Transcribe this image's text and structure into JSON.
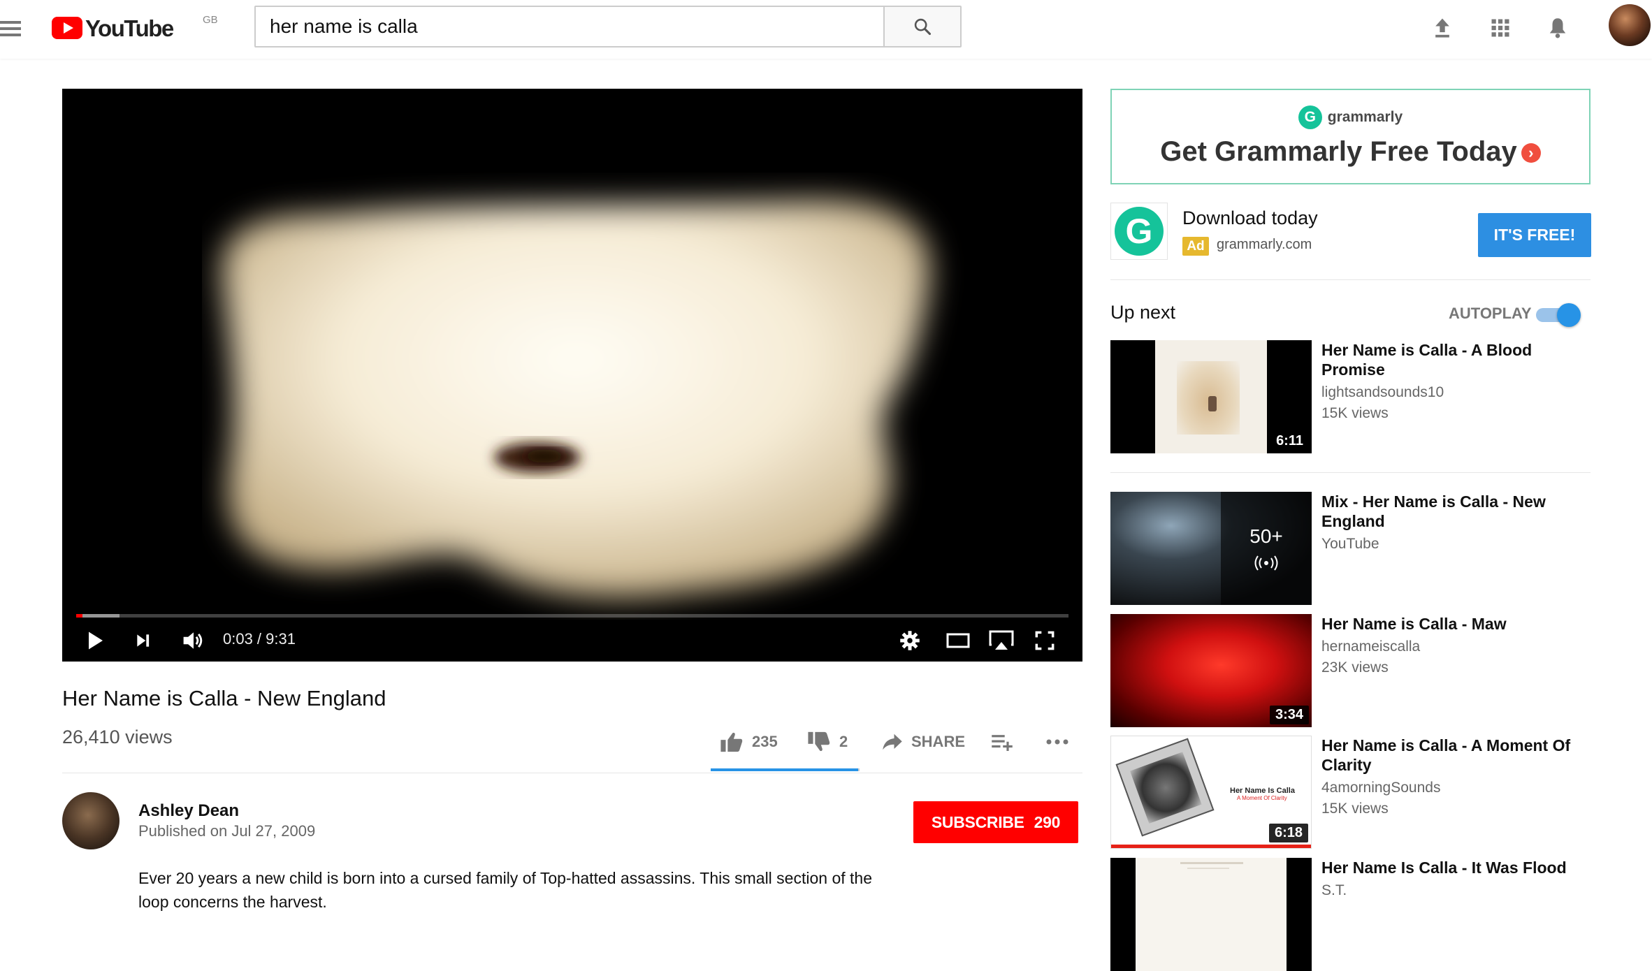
{
  "header": {
    "logo_text": "YouTube",
    "country_code": "GB",
    "search_value": "her name is calla",
    "search_placeholder": "Search"
  },
  "player": {
    "time_display": "0:03 / 9:31",
    "progress_played_fraction": 0.006,
    "progress_loaded_fraction": 0.044
  },
  "video": {
    "title": "Her Name is Calla - New England",
    "views": "26,410 views",
    "likes": "235",
    "dislikes": "2",
    "like_fraction": 0.99,
    "share_label": "SHARE"
  },
  "owner": {
    "name": "Ashley Dean",
    "published": "Published on Jul 27, 2009",
    "subscribe_label": "SUBSCRIBE",
    "subscriber_count": "290"
  },
  "description": "Ever 20 years a new child is born into a cursed family of Top-hatted assassins. This small section of the loop concerns the harvest.",
  "ad": {
    "brand": "grammarly",
    "headline": "Get Grammarly Free Today",
    "cta_text": "Download today",
    "badge": "Ad",
    "domain": "grammarly.com",
    "button_label": "IT'S FREE!"
  },
  "up_next": {
    "label": "Up next",
    "autoplay_label": "AUTOPLAY",
    "autoplay_on": true
  },
  "recommendations": [
    {
      "title": "Her Name is Calla - A Blood Promise",
      "channel": "lightsandsounds10",
      "views": "15K views",
      "duration": "6:11"
    },
    {
      "title": "Mix - Her Name is Calla - New England",
      "channel": "YouTube",
      "views": "",
      "duration": "",
      "playlist_count": "50+"
    },
    {
      "title": "Her Name is Calla - Maw",
      "channel": "hernameiscalla",
      "views": "23K views",
      "duration": "3:34"
    },
    {
      "title": "Her Name is Calla - A Moment Of Clarity",
      "channel": "4amorningSounds",
      "views": "15K views",
      "duration": "6:18",
      "thumb_text_1": "Her Name Is Calla",
      "thumb_text_2": "A Moment Of Clarity"
    },
    {
      "title": "Her Name Is Calla - It Was Flood",
      "channel": "S.T.",
      "views": "",
      "duration": ""
    }
  ],
  "colors": {
    "brand_red": "#ff0000",
    "accent_blue": "#2793e6",
    "grammarly_green": "#15c39a"
  }
}
